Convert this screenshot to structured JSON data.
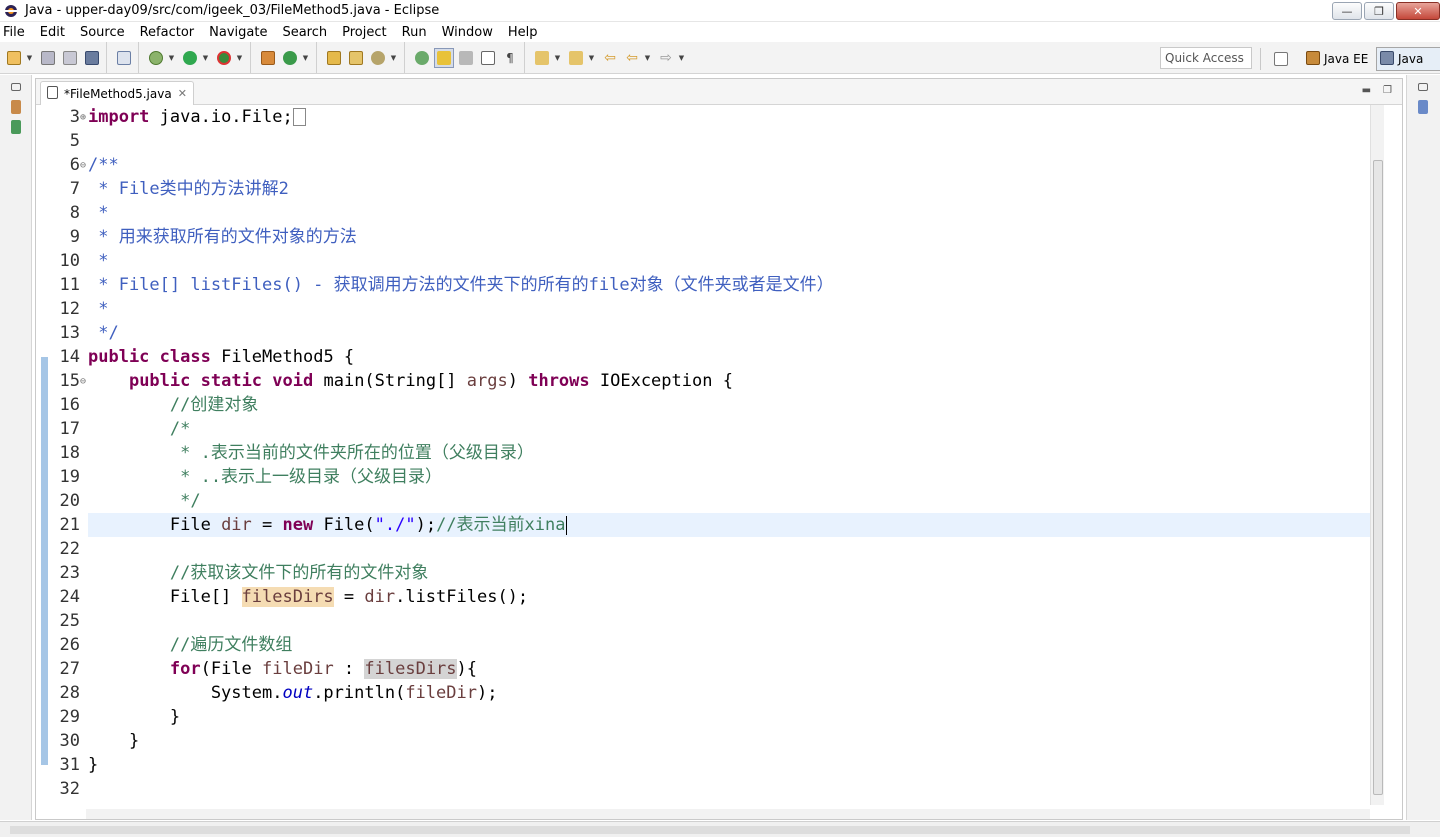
{
  "window": {
    "title": "Java - upper-day09/src/com/igeek_03/FileMethod5.java - Eclipse",
    "buttons": [
      "minimize",
      "maximize",
      "close"
    ]
  },
  "menu": [
    "File",
    "Edit",
    "Source",
    "Refactor",
    "Navigate",
    "Search",
    "Project",
    "Run",
    "Window",
    "Help"
  ],
  "toolbar": {
    "quick_access_placeholder": "Quick Access",
    "perspectives": [
      {
        "label": "Java EE",
        "icon": "java-ee-perspective-icon"
      },
      {
        "label": "Java",
        "icon": "java-perspective-icon",
        "active": true
      }
    ]
  },
  "editor": {
    "tab_label": "*FileMethod5.java",
    "tab_icon": "java-file-icon",
    "current_line": 21,
    "line_numbers": [
      "3",
      "5",
      "6",
      "7",
      "8",
      "9",
      "10",
      "11",
      "12",
      "13",
      "14",
      "15",
      "16",
      "17",
      "18",
      "19",
      "20",
      "21",
      "22",
      "23",
      "24",
      "25",
      "26",
      "27",
      "28",
      "29",
      "30",
      "31",
      "32"
    ],
    "code_lines": [
      "import java.io.File;",
      "",
      "/**",
      " * File类中的方法讲解2",
      " *",
      " * 用来获取所有的文件对象的方法",
      " *",
      " * File[] listFiles() - 获取调用方法的文件夹下的所有的file对象（文件夹或者是文件）",
      " *",
      " */",
      "public class FileMethod5 {",
      "    public static void main(String[] args) throws IOException {",
      "        //创建对象",
      "        /*",
      "         * .表示当前的文件夹所在的位置（父级目录）",
      "         * ..表示上一级目录（父级目录）",
      "         */",
      "        File dir = new File(\"./\");//表示当前xina",
      "",
      "        //获取该文件下的所有的文件对象",
      "        File[] filesDirs = dir.listFiles();",
      "",
      "        //遍历文件数组",
      "        for(File fileDir : filesDirs){",
      "            System.out.println(fileDir);",
      "        }",
      "    }",
      "}",
      ""
    ]
  },
  "colors": {
    "keyword": "#7f0055",
    "comment": "#3f7f5f",
    "javadoc": "#3f5fbf",
    "string": "#2a00ff",
    "current_line_bg": "#e8f2fe",
    "occurrence_write": "#f5dcb3",
    "occurrence_read": "#d4d4d4"
  }
}
